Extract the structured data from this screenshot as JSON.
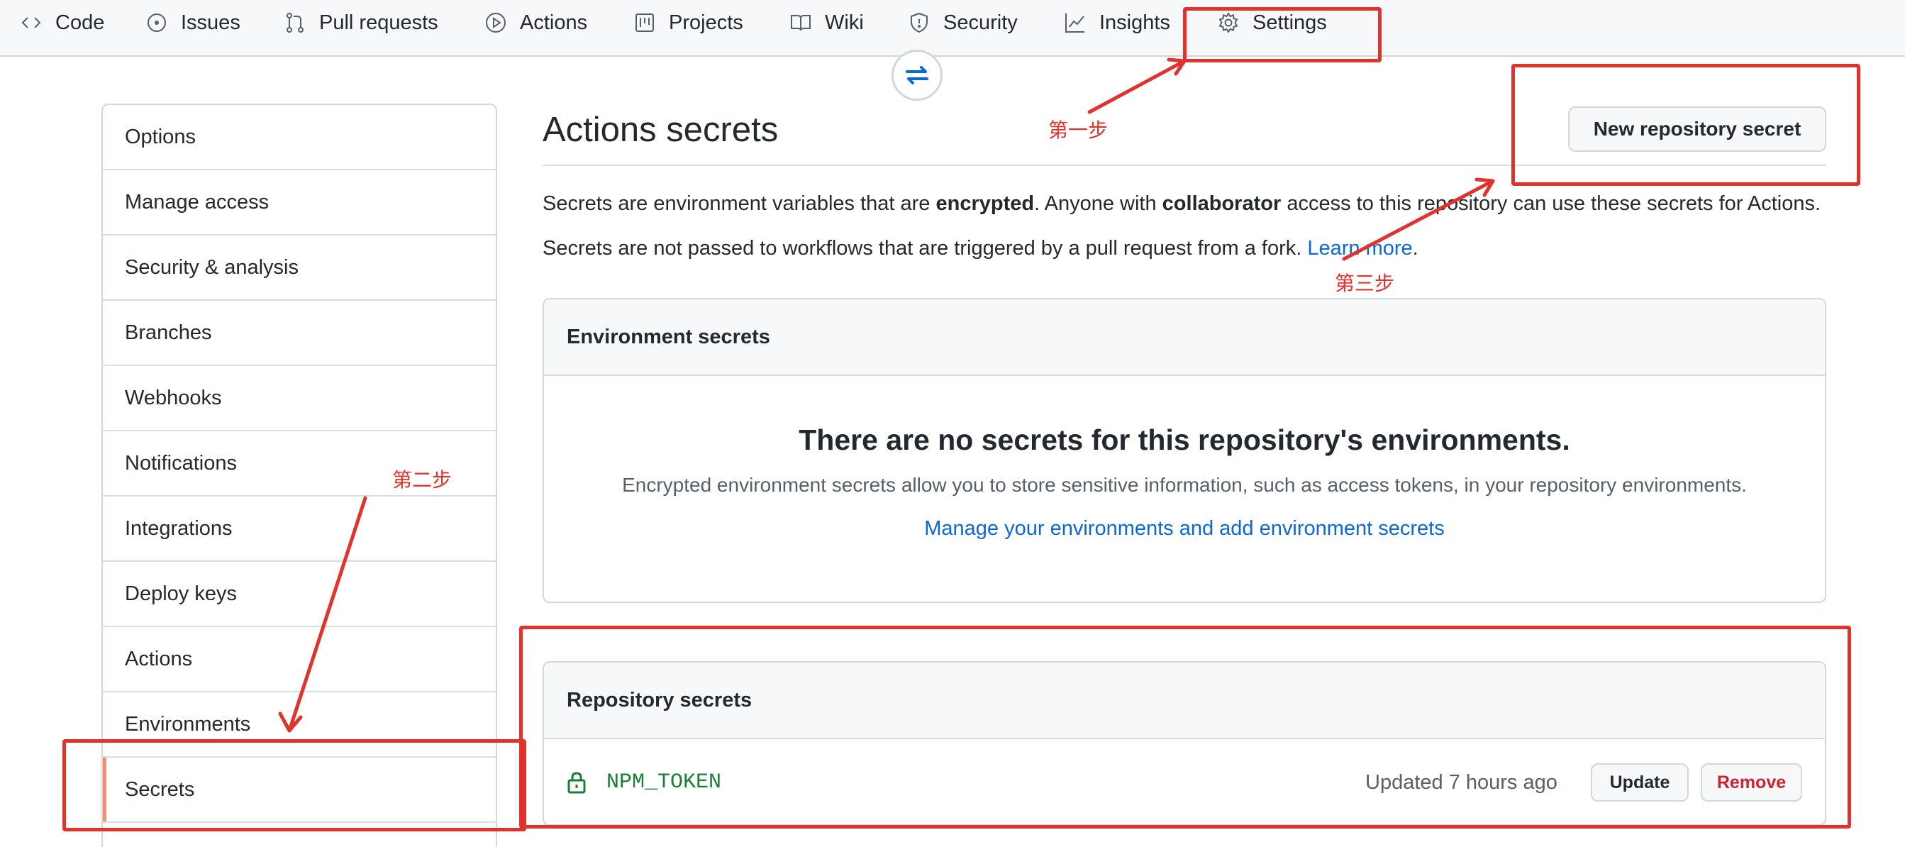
{
  "nav": {
    "tabs": [
      {
        "label": "Code",
        "icon": "code-icon"
      },
      {
        "label": "Issues",
        "icon": "issue-icon"
      },
      {
        "label": "Pull requests",
        "icon": "pull-request-icon"
      },
      {
        "label": "Actions",
        "icon": "play-icon"
      },
      {
        "label": "Projects",
        "icon": "project-icon"
      },
      {
        "label": "Wiki",
        "icon": "book-icon"
      },
      {
        "label": "Security",
        "icon": "shield-icon"
      },
      {
        "label": "Insights",
        "icon": "graph-icon"
      },
      {
        "label": "Settings",
        "icon": "gear-icon"
      }
    ]
  },
  "sidebar": {
    "items": [
      {
        "label": "Options"
      },
      {
        "label": "Manage access"
      },
      {
        "label": "Security & analysis"
      },
      {
        "label": "Branches"
      },
      {
        "label": "Webhooks"
      },
      {
        "label": "Notifications"
      },
      {
        "label": "Integrations"
      },
      {
        "label": "Deploy keys"
      },
      {
        "label": "Actions"
      },
      {
        "label": "Environments"
      },
      {
        "label": "Secrets",
        "active": true
      }
    ]
  },
  "main": {
    "title": "Actions secrets",
    "new_secret_button": "New repository secret",
    "desc1": {
      "a": "Secrets are environment variables that are ",
      "b": "encrypted",
      "c": ". Anyone with ",
      "d": "collaborator",
      "e": " access to this repository can use these secrets for Actions."
    },
    "desc2": {
      "a": "Secrets are not passed to workflows that are triggered by a pull request from a fork. ",
      "link": "Learn more",
      "b": "."
    },
    "env_secrets": {
      "header": "Environment secrets",
      "blank_title": "There are no secrets for this repository's environments.",
      "blank_text": "Encrypted environment secrets allow you to store sensitive information, such as access tokens, in your repository environments.",
      "manage_link": "Manage your environments and add environment secrets"
    },
    "repo_secrets": {
      "header": "Repository secrets",
      "rows": [
        {
          "name": "NPM_TOKEN",
          "updated": "Updated 7 hours ago",
          "update_label": "Update",
          "remove_label": "Remove"
        }
      ]
    }
  },
  "annotations": {
    "step1": "第一步",
    "step2": "第二步",
    "step3": "第三步",
    "color": "#e0332b"
  },
  "colors": {
    "link": "#0969da",
    "secret_name": "#1a7f37",
    "danger": "#cf222e",
    "active_indicator": "#fd8c73"
  }
}
